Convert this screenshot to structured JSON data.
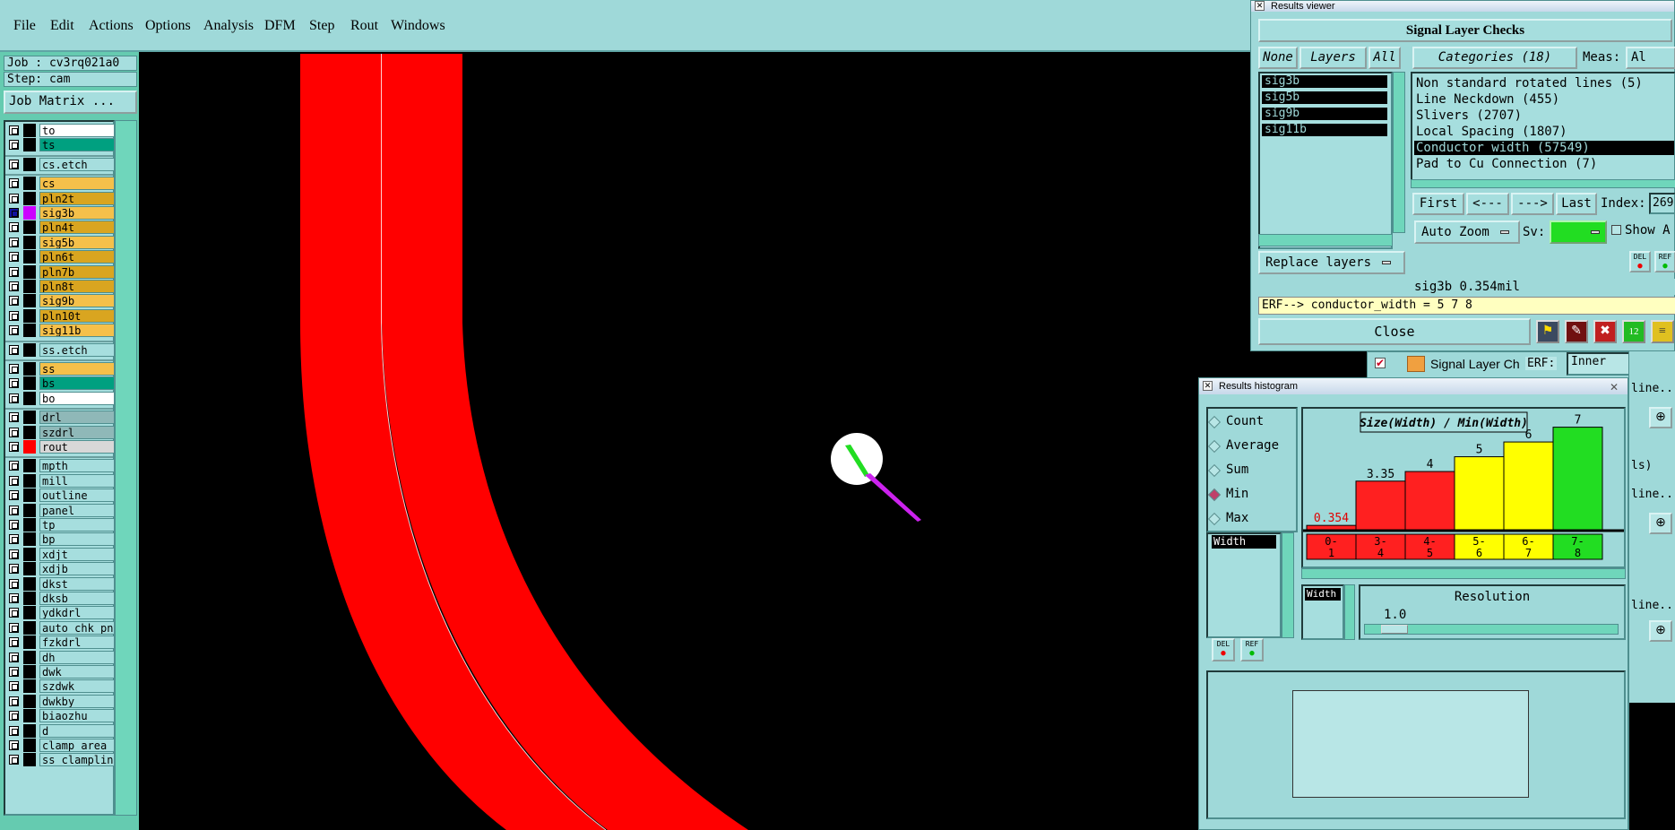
{
  "menubar": {
    "items": [
      "File",
      "Edit",
      "Actions",
      "Options",
      "Analysis",
      "DFM",
      "Step",
      "Rout",
      "Windows"
    ]
  },
  "left_panel": {
    "job_label": "Job : cv3rq021a0",
    "step_label": "Step: cam",
    "job_matrix_button": "Job Matrix ...",
    "layers": [
      {
        "name": "to",
        "color": "#ffffff"
      },
      {
        "name": "ts",
        "color": "#00a080"
      },
      {
        "name": "cs.etch",
        "color": "#a6dede"
      },
      {
        "name": "cs",
        "color": "#f5c04a"
      },
      {
        "name": "pln2t",
        "color": "#d9a520"
      },
      {
        "name": "sig3b",
        "color": "#f5c04a"
      },
      {
        "name": "pln4t",
        "color": "#d9a520"
      },
      {
        "name": "sig5b",
        "color": "#f5c04a"
      },
      {
        "name": "pln6t",
        "color": "#d9a520"
      },
      {
        "name": "pln7b",
        "color": "#d9a520"
      },
      {
        "name": "pln8t",
        "color": "#d9a520"
      },
      {
        "name": "sig9b",
        "color": "#f5c04a"
      },
      {
        "name": "pln10t",
        "color": "#d9a520"
      },
      {
        "name": "sig11b",
        "color": "#f5c04a"
      },
      {
        "name": "ss.etch",
        "color": "#a6dede"
      },
      {
        "name": "ss",
        "color": "#f5c04a"
      },
      {
        "name": "bs",
        "color": "#00a080"
      },
      {
        "name": "bo",
        "color": "#ffffff"
      },
      {
        "name": "drl",
        "color": "#8fb8b8"
      },
      {
        "name": "szdrl",
        "color": "#8fb8b8"
      },
      {
        "name": "rout",
        "color": "#d8d8d8"
      },
      {
        "name": "mpth",
        "color": "#a6dede"
      },
      {
        "name": "mill",
        "color": "#a6dede"
      },
      {
        "name": "outline",
        "color": "#a6dede"
      },
      {
        "name": "panel",
        "color": "#a6dede"
      },
      {
        "name": "tp",
        "color": "#a6dede"
      },
      {
        "name": "bp",
        "color": "#a6dede"
      },
      {
        "name": "xdjt",
        "color": "#a6dede"
      },
      {
        "name": "xdjb",
        "color": "#a6dede"
      },
      {
        "name": "dkst",
        "color": "#a6dede"
      },
      {
        "name": "dksb",
        "color": "#a6dede"
      },
      {
        "name": "ydkdrl",
        "color": "#a6dede"
      },
      {
        "name": "auto_chk_pn",
        "color": "#a6dede"
      },
      {
        "name": "fzkdrl",
        "color": "#a6dede"
      },
      {
        "name": "dh",
        "color": "#a6dede"
      },
      {
        "name": "dwk",
        "color": "#a6dede"
      },
      {
        "name": "szdwk",
        "color": "#a6dede"
      },
      {
        "name": "dwkby",
        "color": "#a6dede"
      },
      {
        "name": "biaozhu",
        "color": "#a6dede"
      },
      {
        "name": "d",
        "color": "#a6dede"
      },
      {
        "name": "clamp_area",
        "color": "#a6dede"
      },
      {
        "name": "ss_clampline",
        "color": "#a6dede"
      }
    ]
  },
  "results_viewer": {
    "window_title": "Results viewer",
    "header": "Signal Layer Checks",
    "none_button": "None",
    "layers_button": "Layers",
    "all_button": "All",
    "categories_button": "Categories (18)",
    "meas_label": "Meas:",
    "meas_value": "Al",
    "selected_layers": [
      "sig3b",
      "sig5b",
      "sig9b",
      "sig11b"
    ],
    "categories": [
      "Non standard rotated lines (5)",
      "Line Neckdown (455)",
      "Slivers (2707)",
      "Local Spacing (1807)",
      "Conductor width (57549)",
      "Pad to Cu Connection (7)"
    ],
    "selected_category_index": 4,
    "first_button": "First",
    "prev_button": "<---",
    "next_button": "--->",
    "last_button": "Last",
    "index_label": "Index:",
    "index_value": "269",
    "auto_zoom_button": "Auto Zoom",
    "sv_label": "Sv:",
    "show_label": "Show A",
    "replace_layers_button": "Replace layers",
    "del_label": "DEL",
    "ref_label": "REF",
    "result_line": "sig3b 0.354mil",
    "erf_line": "ERF--> conductor_width = 5 7 8",
    "close_button": "Close"
  },
  "background_window": {
    "title": "Signal Layer Ch",
    "erf_label": "ERF:",
    "erf_value": "Inner",
    "side_labels": [
      "line...",
      "ls)",
      "line...",
      "line..."
    ]
  },
  "results_histogram": {
    "window_title": "Results histogram",
    "modes": [
      "Count",
      "Average",
      "Sum",
      "Min",
      "Max"
    ],
    "selected_mode": "Min",
    "attribute": "Width",
    "del_label": "DEL",
    "ref_label": "REF",
    "resolution_label": "Resolution",
    "resolution_value": "1.0",
    "attribute_tag": "Width"
  },
  "chart_data": {
    "type": "bar",
    "title": "Size(Width) / Min(Width)",
    "categories": [
      "0-1",
      "3-4",
      "4-5",
      "5-6",
      "6-7",
      "7-8"
    ],
    "values": [
      0.354,
      3.35,
      4,
      5,
      6,
      7
    ],
    "value_labels": [
      "0.354",
      "3.35",
      "4",
      "5",
      "6",
      "7"
    ],
    "colors": [
      "#ff2020",
      "#ff2020",
      "#ff2020",
      "#ffff00",
      "#ffff00",
      "#22dd22"
    ],
    "ylim": [
      0,
      7.4
    ]
  }
}
